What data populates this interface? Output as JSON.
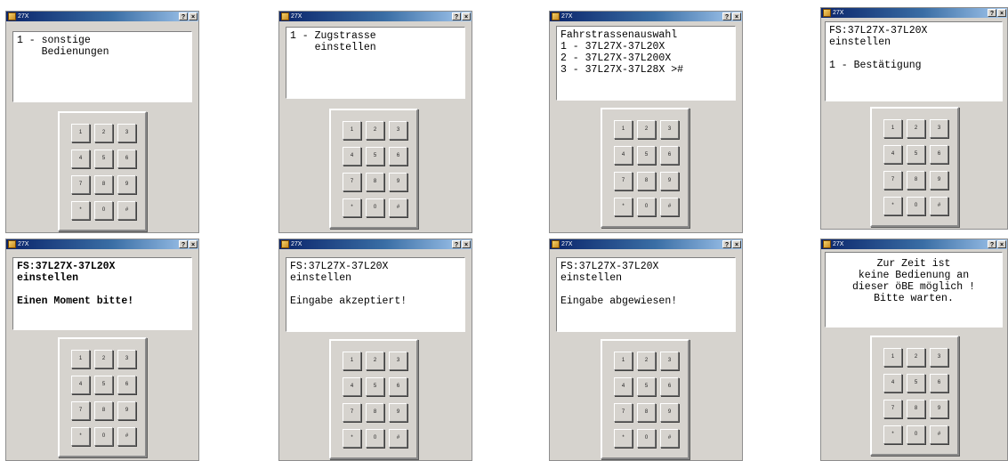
{
  "app_title": "27X",
  "help_glyph": "?",
  "close_glyph": "×",
  "keypad": [
    "1",
    "2",
    "3",
    "4",
    "5",
    "6",
    "7",
    "8",
    "9",
    "*",
    "0",
    "#"
  ],
  "windows": [
    {
      "display_text": "1 - sonstige\n    Bedienungen"
    },
    {
      "display_text": "1 - Zugstrasse\n    einstellen"
    },
    {
      "display_text": "Fahrstrassenauswahl\n1 - 37L27X-37L20X\n2 - 37L27X-37L200X\n3 - 37L27X-37L28X >#"
    },
    {
      "display_text": "FS:37L27X-37L20X\neinstellen\n\n1 - Bestätigung"
    },
    {
      "display_text": "FS:37L27X-37L20X\neinstellen\n\nEinen Moment bitte!"
    },
    {
      "display_text": "FS:37L27X-37L20X\neinstellen\n\nEingabe akzeptiert!"
    },
    {
      "display_text": "FS:37L27X-37L20X\neinstellen\n\nEingabe abgewiesen!"
    },
    {
      "display_text": "Zur Zeit ist\nkeine Bedienung an\ndieser öBE möglich !\nBitte warten."
    }
  ]
}
